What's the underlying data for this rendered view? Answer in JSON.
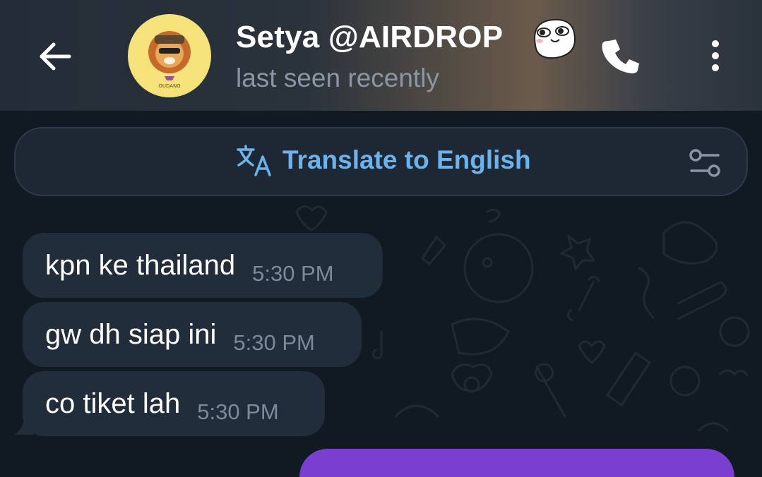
{
  "header": {
    "title": "Setya @AIRDROP",
    "status": "last seen recently",
    "avatar_caption": "OUDANG",
    "avatar_bg": "#f5e27a",
    "back_icon": "arrow-left-icon",
    "call_icon": "phone-icon",
    "menu_icon": "more-vertical-icon"
  },
  "translate": {
    "label": "Translate to English",
    "icon": "translate-icon",
    "settings_icon": "sliders-icon",
    "accent": "#6cb2ec"
  },
  "messages": [
    {
      "text": "kpn ke thailand",
      "time": "5:30 PM"
    },
    {
      "text": "gw dh siap ini",
      "time": "5:30 PM"
    },
    {
      "text": "co tiket lah",
      "time": "5:30 PM"
    }
  ],
  "colors": {
    "background": "#111a23",
    "incoming_bubble": "#212d3b",
    "outgoing_bubble": "#7a3fd1"
  }
}
